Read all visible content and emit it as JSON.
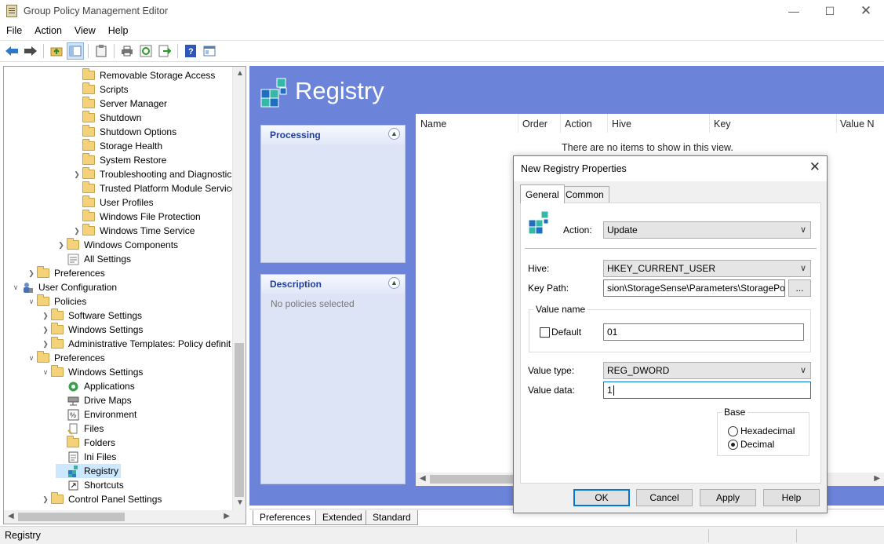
{
  "window": {
    "title": "Group Policy Management Editor"
  },
  "menu": [
    "File",
    "Action",
    "View",
    "Help"
  ],
  "toolbar_icons": [
    "back-arrow-icon",
    "forward-arrow-icon",
    "up-folder-icon",
    "show-hide-tree-icon",
    "clipboard-icon",
    "print-icon",
    "refresh-icon",
    "export-icon",
    "help-icon",
    "properties-icon"
  ],
  "tree": [
    {
      "label": "Removable Storage Access",
      "icon": "folder"
    },
    {
      "label": "Scripts",
      "icon": "folder"
    },
    {
      "label": "Server Manager",
      "icon": "folder"
    },
    {
      "label": "Shutdown",
      "icon": "folder"
    },
    {
      "label": "Shutdown Options",
      "icon": "folder"
    },
    {
      "label": "Storage Health",
      "icon": "folder"
    },
    {
      "label": "System Restore",
      "icon": "folder"
    },
    {
      "label": "Troubleshooting and Diagnostic:",
      "icon": "folder"
    },
    {
      "label": "Trusted Platform Module Service",
      "icon": "folder"
    },
    {
      "label": "User Profiles",
      "icon": "folder"
    },
    {
      "label": "Windows File Protection",
      "icon": "folder"
    },
    {
      "label": "Windows Time Service",
      "icon": "folder"
    },
    {
      "label": "Windows Components",
      "icon": "folder"
    },
    {
      "label": "All Settings",
      "icon": "all-settings"
    },
    {
      "label": "Preferences",
      "icon": "folder"
    },
    {
      "label": "User Configuration",
      "icon": "user-config"
    },
    {
      "label": "Policies",
      "icon": "folder"
    },
    {
      "label": "Software Settings",
      "icon": "folder"
    },
    {
      "label": "Windows Settings",
      "icon": "folder"
    },
    {
      "label": "Administrative Templates: Policy definit",
      "icon": "folder"
    },
    {
      "label": "Preferences",
      "icon": "folder"
    },
    {
      "label": "Windows Settings",
      "icon": "folder"
    },
    {
      "label": "Applications",
      "icon": "applications"
    },
    {
      "label": "Drive Maps",
      "icon": "drive-maps"
    },
    {
      "label": "Environment",
      "icon": "environment"
    },
    {
      "label": "Files",
      "icon": "files"
    },
    {
      "label": "Folders",
      "icon": "folders"
    },
    {
      "label": "Ini Files",
      "icon": "ini-files"
    },
    {
      "label": "Registry",
      "icon": "registry",
      "selected": true
    },
    {
      "label": "Shortcuts",
      "icon": "shortcuts"
    },
    {
      "label": "Control Panel Settings",
      "icon": "folder"
    }
  ],
  "right": {
    "title": "Registry",
    "processing_label": "Processing",
    "description_label": "Description",
    "description_text": "No policies selected",
    "columns": [
      "Name",
      "Order",
      "Action",
      "Hive",
      "Key",
      "Value N"
    ],
    "empty_message": "There are no items to show in this view."
  },
  "bottom_tabs": [
    "Preferences",
    "Extended",
    "Standard"
  ],
  "status": {
    "text": "Registry"
  },
  "dialog": {
    "title": "New Registry Properties",
    "tabs": [
      "General",
      "Common"
    ],
    "action_label": "Action:",
    "action_value": "Update",
    "hive_label": "Hive:",
    "hive_value": "HKEY_CURRENT_USER",
    "keypath_label": "Key Path:",
    "keypath_value": "sion\\StorageSense\\Parameters\\StoragePolicy",
    "browse_label": "...",
    "valuename_group": "Value name",
    "default_label": "Default",
    "valuename_value": "01",
    "valuetype_label": "Value type:",
    "valuetype_value": "REG_DWORD",
    "valuedata_label": "Value data:",
    "valuedata_value": "1",
    "base_group": "Base",
    "hex_label": "Hexadecimal",
    "decimal_label": "Decimal",
    "buttons": {
      "ok": "OK",
      "cancel": "Cancel",
      "apply": "Apply",
      "help": "Help"
    }
  }
}
